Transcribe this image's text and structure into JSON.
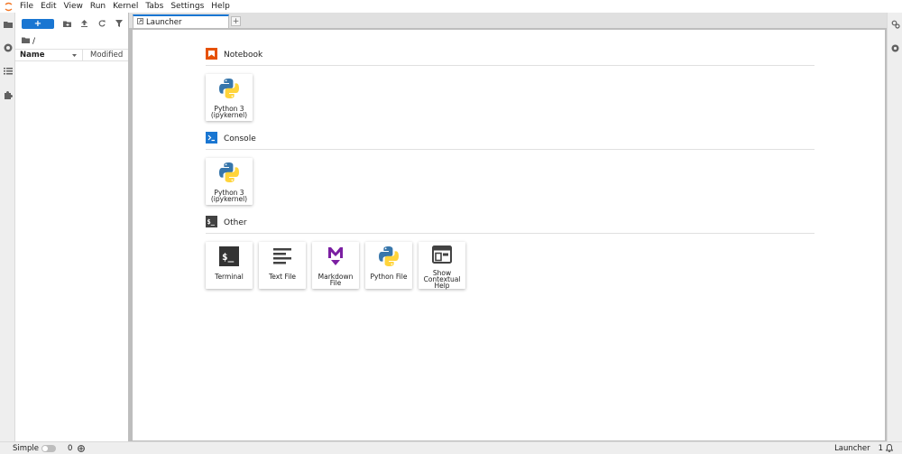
{
  "menubar": {
    "items": [
      "File",
      "Edit",
      "View",
      "Run",
      "Kernel",
      "Tabs",
      "Settings",
      "Help"
    ]
  },
  "left_bar": {
    "icons": [
      "folder-icon",
      "running-icon",
      "toc-icon",
      "extension-icon"
    ]
  },
  "filebrowser": {
    "new_label": "+",
    "breadcrumb": "/",
    "columns": {
      "name": "Name",
      "modified": "Modified"
    }
  },
  "tabs": [
    {
      "label": "Launcher"
    }
  ],
  "tab_add_label": "+",
  "launcher": {
    "sections": [
      {
        "title": "Notebook",
        "icon": "notebook-icon",
        "cards": [
          {
            "label": "Python 3 (ipykernel)",
            "icon": "python-icon"
          }
        ]
      },
      {
        "title": "Console",
        "icon": "console-icon",
        "cards": [
          {
            "label": "Python 3 (ipykernel)",
            "icon": "python-icon"
          }
        ]
      },
      {
        "title": "Other",
        "icon": "other-icon",
        "cards": [
          {
            "label": "Terminal",
            "icon": "terminal-icon"
          },
          {
            "label": "Text File",
            "icon": "text-file-icon"
          },
          {
            "label": "Markdown File",
            "icon": "markdown-icon"
          },
          {
            "label": "Python File",
            "icon": "python-icon"
          },
          {
            "label": "Show Contextual Help",
            "icon": "help-icon"
          }
        ]
      }
    ]
  },
  "statusbar": {
    "mode_label": "Simple",
    "kernel_count": "0",
    "right_label": "Launcher",
    "right_count": "1"
  },
  "colors": {
    "accent": "#1976d2",
    "notebook_orange": "#e65100",
    "markdown_purple": "#7b1fa2",
    "python_blue": "#3776ab",
    "python_yellow": "#ffd43b"
  }
}
